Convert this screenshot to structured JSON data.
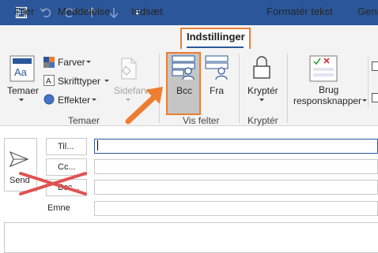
{
  "quick_access": {
    "icons": [
      "save-icon",
      "undo-icon",
      "redo-icon",
      "up-arrow-icon",
      "down-arrow-icon",
      "customize-qat-icon"
    ]
  },
  "tabs": [
    {
      "label": "Filer"
    },
    {
      "label": "Meddelelse"
    },
    {
      "label": "Indsæt"
    },
    {
      "label": "Indstillinger",
      "active": true
    },
    {
      "label": "Formatér tekst"
    },
    {
      "label": "Genr"
    }
  ],
  "ribbon": {
    "temaer": {
      "button_label": "Temaer",
      "colors_label": "Farver",
      "fonts_label": "Skrifttyper",
      "effects_label": "Effekter",
      "page_color_label": "Sidefarve",
      "group_label": "Temaer"
    },
    "vis_felter": {
      "bcc_label": "Bcc",
      "from_label": "Fra",
      "group_label": "Vis felter"
    },
    "krypter": {
      "button_label": "Kryptér",
      "group_label": "Kryptér"
    },
    "responses": {
      "line1": "Brug",
      "line2": "responsknapper"
    }
  },
  "compose": {
    "send_label": "Send",
    "to_label": "Til...",
    "cc_label": "Cc...",
    "bcc_label": "Bcc...",
    "subject_label": "Emne",
    "to_value": "",
    "cc_value": "",
    "bcc_value": "",
    "subject_value": ""
  },
  "colors": {
    "title_bar": "#2b579a",
    "highlight": "#ed7d31",
    "strike": "#e05252"
  }
}
